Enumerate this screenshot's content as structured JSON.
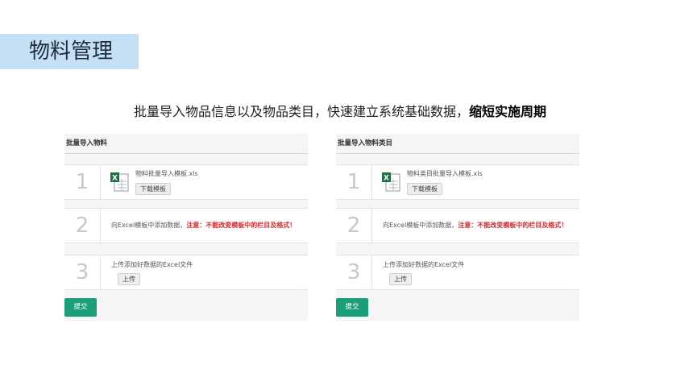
{
  "page": {
    "title": "物料管理",
    "headline_normal": "批量导入物品信息以及物品类目，快速建立系统基础数据，",
    "headline_bold": "缩短实施周期"
  },
  "colors": {
    "title_band": "#c5dff4",
    "submit_button": "#1b9e7a",
    "warning_text": "#d9262c",
    "excel_green": "#1e7145"
  },
  "panels": [
    {
      "header": "批量导入物料",
      "step1": {
        "number": "1",
        "file_name": "物料批量导入模板.xls",
        "file_icon": "excel-file-icon",
        "download_label": "下载模板"
      },
      "step2": {
        "number": "2",
        "text": "向Excel模板中添加数据，",
        "warning": "注意：不能改变模板中的栏目及格式！"
      },
      "step3": {
        "number": "3",
        "text": "上传添加好数据的Excel文件",
        "upload_label": "上传"
      },
      "submit_label": "提交"
    },
    {
      "header": "批量导入物料类目",
      "step1": {
        "number": "1",
        "file_name": "物料类目批量导入模板.xls",
        "file_icon": "excel-file-icon",
        "download_label": "下载模板"
      },
      "step2": {
        "number": "2",
        "text": "向Excel模板中添加数据，",
        "warning": "注意：不能改变模板中的栏目及格式！"
      },
      "step3": {
        "number": "3",
        "text": "上传添加好数据的Excel文件",
        "upload_label": "上传"
      },
      "submit_label": "提交"
    }
  ]
}
